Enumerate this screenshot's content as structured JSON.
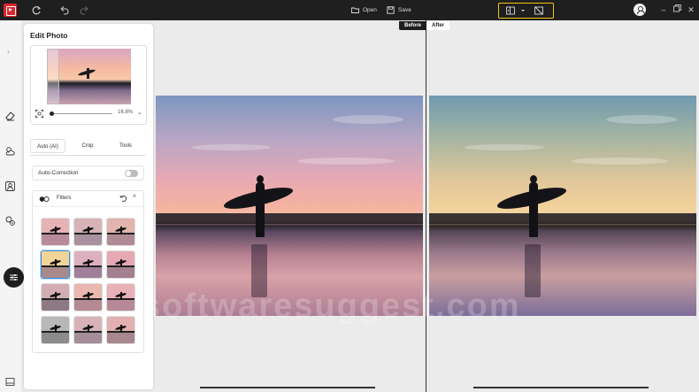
{
  "toolbar": {
    "open_label": "Open",
    "save_label": "Save"
  },
  "panel": {
    "title": "Edit Photo",
    "zoom_value": "16.8%",
    "tabs": [
      {
        "label": "Auto (AI)",
        "active": true
      },
      {
        "label": "Crop",
        "active": false
      },
      {
        "label": "Tools",
        "active": false
      }
    ],
    "auto_correction_label": "Auto-Correction",
    "auto_correction_on": false,
    "filters_label": "Filters",
    "filters": [
      {
        "sky": "#e7b2b6",
        "sea": "#b88a9c",
        "selected": false
      },
      {
        "sky": "#d7b3b8",
        "sea": "#a8909e",
        "selected": false
      },
      {
        "sky": "#e1b4ad",
        "sea": "#b08a94",
        "selected": false
      },
      {
        "sky": "#f1d499",
        "sea": "#a88a8a",
        "selected": true
      },
      {
        "sky": "#ddb0c0",
        "sea": "#9f7f9a",
        "selected": false
      },
      {
        "sky": "#e6a9b3",
        "sea": "#a3808f",
        "selected": false
      },
      {
        "sky": "#d2aeb2",
        "sea": "#8e7a85",
        "selected": false
      },
      {
        "sky": "#eab7b1",
        "sea": "#b58b93",
        "selected": false
      },
      {
        "sky": "#e8b1b8",
        "sea": "#b78997",
        "selected": false
      },
      {
        "sky": "#b8b8b8",
        "sea": "#8c8c8c",
        "selected": false
      },
      {
        "sky": "#d8b2b9",
        "sea": "#a48c98",
        "selected": false
      },
      {
        "sky": "#e3b0b0",
        "sea": "#a9878f",
        "selected": false
      }
    ]
  },
  "canvas": {
    "before_label": "Before",
    "after_label": "After"
  },
  "watermark": "softwaresuggest.com",
  "colors": {
    "accent": "#3a8dde",
    "brand": "#e0242b",
    "highlight": "#f2c511",
    "topbar": "#1f1f1f"
  }
}
